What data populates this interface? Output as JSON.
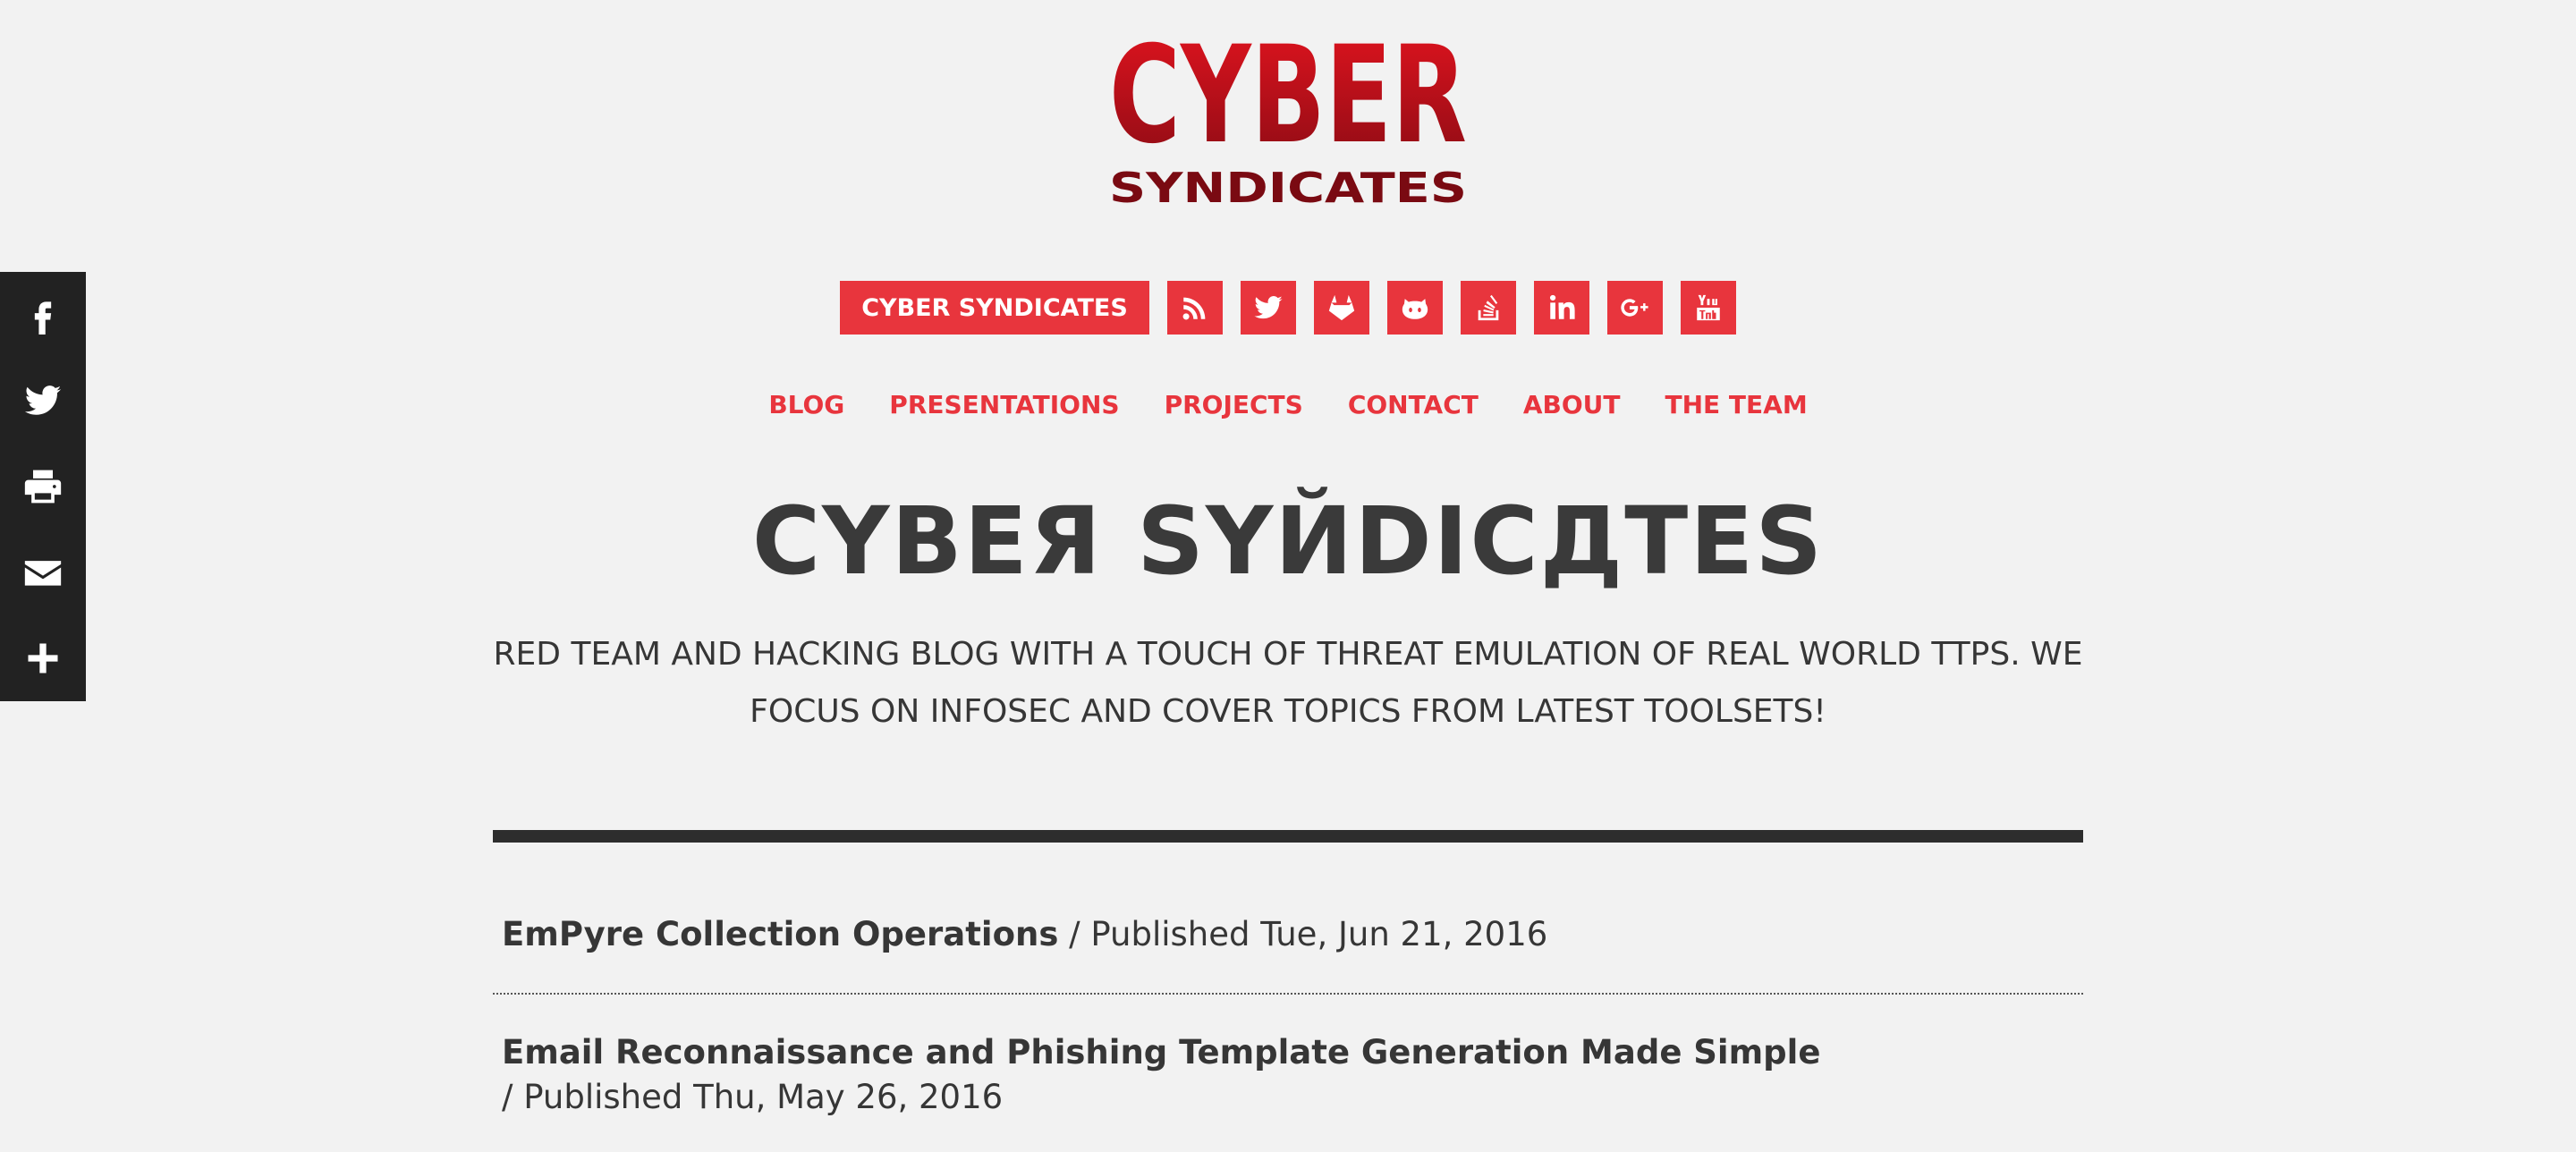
{
  "logo": {
    "main_text": "CYBER",
    "sub_text": "SYNDICATES",
    "colors": {
      "primary": "#c8101e",
      "dark": "#7a0a12"
    }
  },
  "share_bar": {
    "items": [
      {
        "icon": "facebook-icon"
      },
      {
        "icon": "twitter-icon"
      },
      {
        "icon": "print-icon"
      },
      {
        "icon": "email-icon"
      },
      {
        "icon": "plus-icon"
      }
    ]
  },
  "header_buttons": {
    "site_label": "CYBER SYNDICATES",
    "icons": [
      "rss-icon",
      "twitter-icon",
      "gitlab-icon",
      "github-icon",
      "stackoverflow-icon",
      "linkedin-icon",
      "googleplus-icon",
      "youtube-icon"
    ]
  },
  "nav": {
    "items": [
      "BLOG",
      "PRESENTATIONS",
      "PROJECTS",
      "CONTACT",
      "ABOUT",
      "THE TEAM"
    ]
  },
  "hero": {
    "title": "CYBEЯ SYЙDICДTES",
    "tagline": "RED TEAM AND HACKING BLOG WITH A TOUCH OF THREAT EMULATION OF REAL WORLD TTPS. WE FOCUS ON INFOSEC AND COVER TOPICS FROM LATEST TOOLSETS!"
  },
  "posts": [
    {
      "title": "EmPyre Collection Operations",
      "meta": " / Published Tue, Jun 21, 2016"
    },
    {
      "title": "Email Reconnaissance and Phishing Template Generation Made Simple",
      "meta": "/ Published Thu, May 26, 2016"
    }
  ],
  "colors": {
    "accent": "#e8353d",
    "background": "#f2f2f2",
    "text": "#363636",
    "sidebar": "#222222"
  }
}
